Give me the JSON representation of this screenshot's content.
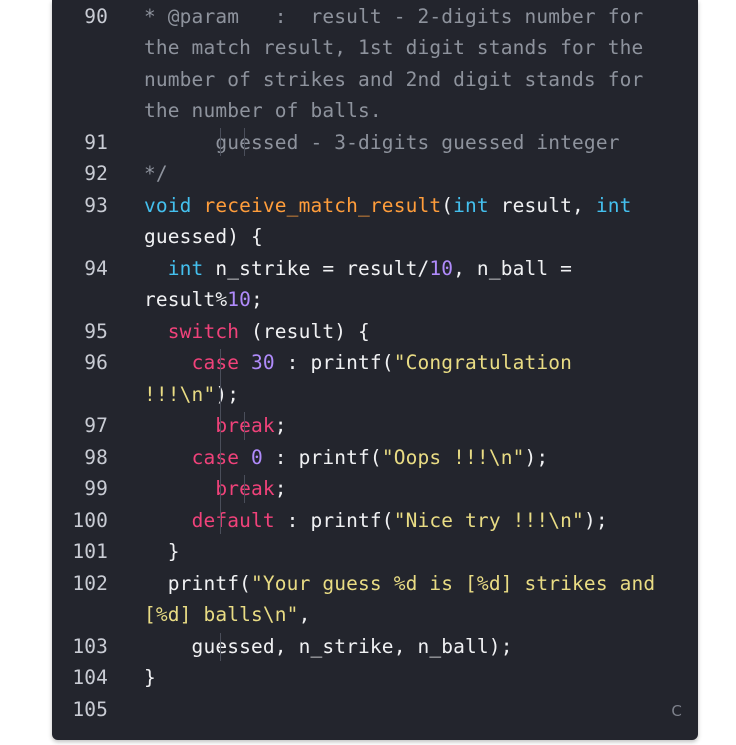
{
  "editor": {
    "language_badge": "C",
    "lines": [
      {
        "number": "90",
        "visual": [
          [
            {
              "c": "cm",
              "t": "* @param   :  result - 2-digits number for"
            }
          ],
          [
            {
              "c": "cm",
              "t": "the match result, 1st digit stands for the"
            }
          ],
          [
            {
              "c": "cm",
              "t": "number of strikes and 2nd digit stands for"
            }
          ],
          [
            {
              "c": "cm",
              "t": "the number of balls."
            }
          ]
        ]
      },
      {
        "number": "91",
        "visual": [
          [
            {
              "c": "cm",
              "t": "      guessed - 3-digits guessed integer"
            }
          ]
        ]
      },
      {
        "number": "92",
        "visual": [
          [
            {
              "c": "cm",
              "t": "*/"
            }
          ]
        ]
      },
      {
        "number": "93",
        "visual": [
          [
            {
              "c": "ty",
              "t": "void"
            },
            {
              "c": "pl",
              "t": " "
            },
            {
              "c": "fn",
              "t": "receive_match_result"
            },
            {
              "c": "pl",
              "t": "("
            },
            {
              "c": "ty",
              "t": "int"
            },
            {
              "c": "pl",
              "t": " result, "
            },
            {
              "c": "ty",
              "t": "int"
            }
          ],
          [
            {
              "c": "pl",
              "t": "guessed) {"
            }
          ]
        ]
      },
      {
        "number": "94",
        "visual": [
          [
            {
              "c": "pl",
              "t": "  "
            },
            {
              "c": "ty",
              "t": "int"
            },
            {
              "c": "pl",
              "t": " n_strike = result/"
            },
            {
              "c": "num",
              "t": "10"
            },
            {
              "c": "pl",
              "t": ", n_ball ="
            }
          ],
          [
            {
              "c": "pl",
              "t": "result%"
            },
            {
              "c": "num",
              "t": "10"
            },
            {
              "c": "pl",
              "t": ";"
            }
          ]
        ]
      },
      {
        "number": "95",
        "visual": [
          [
            {
              "c": "pl",
              "t": "  "
            },
            {
              "c": "kw",
              "t": "switch"
            },
            {
              "c": "pl",
              "t": " (result) {"
            }
          ]
        ]
      },
      {
        "number": "96",
        "visual": [
          [
            {
              "c": "pl",
              "t": "    "
            },
            {
              "c": "kw",
              "t": "case"
            },
            {
              "c": "pl",
              "t": " "
            },
            {
              "c": "num",
              "t": "30"
            },
            {
              "c": "pl",
              "t": " : printf("
            },
            {
              "c": "str",
              "t": "\"Congratulation"
            }
          ],
          [
            {
              "c": "str",
              "t": "!!!\\n\""
            },
            {
              "c": "pl",
              "t": ");"
            }
          ]
        ]
      },
      {
        "number": "97",
        "visual": [
          [
            {
              "c": "pl",
              "t": "      "
            },
            {
              "c": "kw",
              "t": "break"
            },
            {
              "c": "pl",
              "t": ";"
            }
          ]
        ]
      },
      {
        "number": "98",
        "visual": [
          [
            {
              "c": "pl",
              "t": "    "
            },
            {
              "c": "kw",
              "t": "case"
            },
            {
              "c": "pl",
              "t": " "
            },
            {
              "c": "num",
              "t": "0"
            },
            {
              "c": "pl",
              "t": " : printf("
            },
            {
              "c": "str",
              "t": "\"Oops !!!\\n\""
            },
            {
              "c": "pl",
              "t": ");"
            }
          ]
        ]
      },
      {
        "number": "99",
        "visual": [
          [
            {
              "c": "pl",
              "t": "      "
            },
            {
              "c": "kw",
              "t": "break"
            },
            {
              "c": "pl",
              "t": ";"
            }
          ]
        ]
      },
      {
        "number": "100",
        "visual": [
          [
            {
              "c": "pl",
              "t": "    "
            },
            {
              "c": "kw",
              "t": "default"
            },
            {
              "c": "pl",
              "t": " : printf("
            },
            {
              "c": "str",
              "t": "\"Nice try !!!\\n\""
            },
            {
              "c": "pl",
              "t": ");"
            }
          ]
        ]
      },
      {
        "number": "101",
        "visual": [
          [
            {
              "c": "pl",
              "t": "  }"
            }
          ]
        ]
      },
      {
        "number": "102",
        "visual": [
          [
            {
              "c": "pl",
              "t": "  printf("
            },
            {
              "c": "str",
              "t": "\"Your guess %d is [%d] strikes and"
            }
          ],
          [
            {
              "c": "str",
              "t": "[%d] balls\\n\""
            },
            {
              "c": "pl",
              "t": ","
            }
          ]
        ]
      },
      {
        "number": "103",
        "visual": [
          [
            {
              "c": "pl",
              "t": "    guessed, n_strike, n_ball);"
            }
          ]
        ]
      },
      {
        "number": "104",
        "visual": [
          [
            {
              "c": "pl",
              "t": "}"
            }
          ]
        ]
      },
      {
        "number": "105",
        "visual": [
          [
            {
              "c": "pl",
              "t": ""
            }
          ]
        ]
      }
    ]
  }
}
